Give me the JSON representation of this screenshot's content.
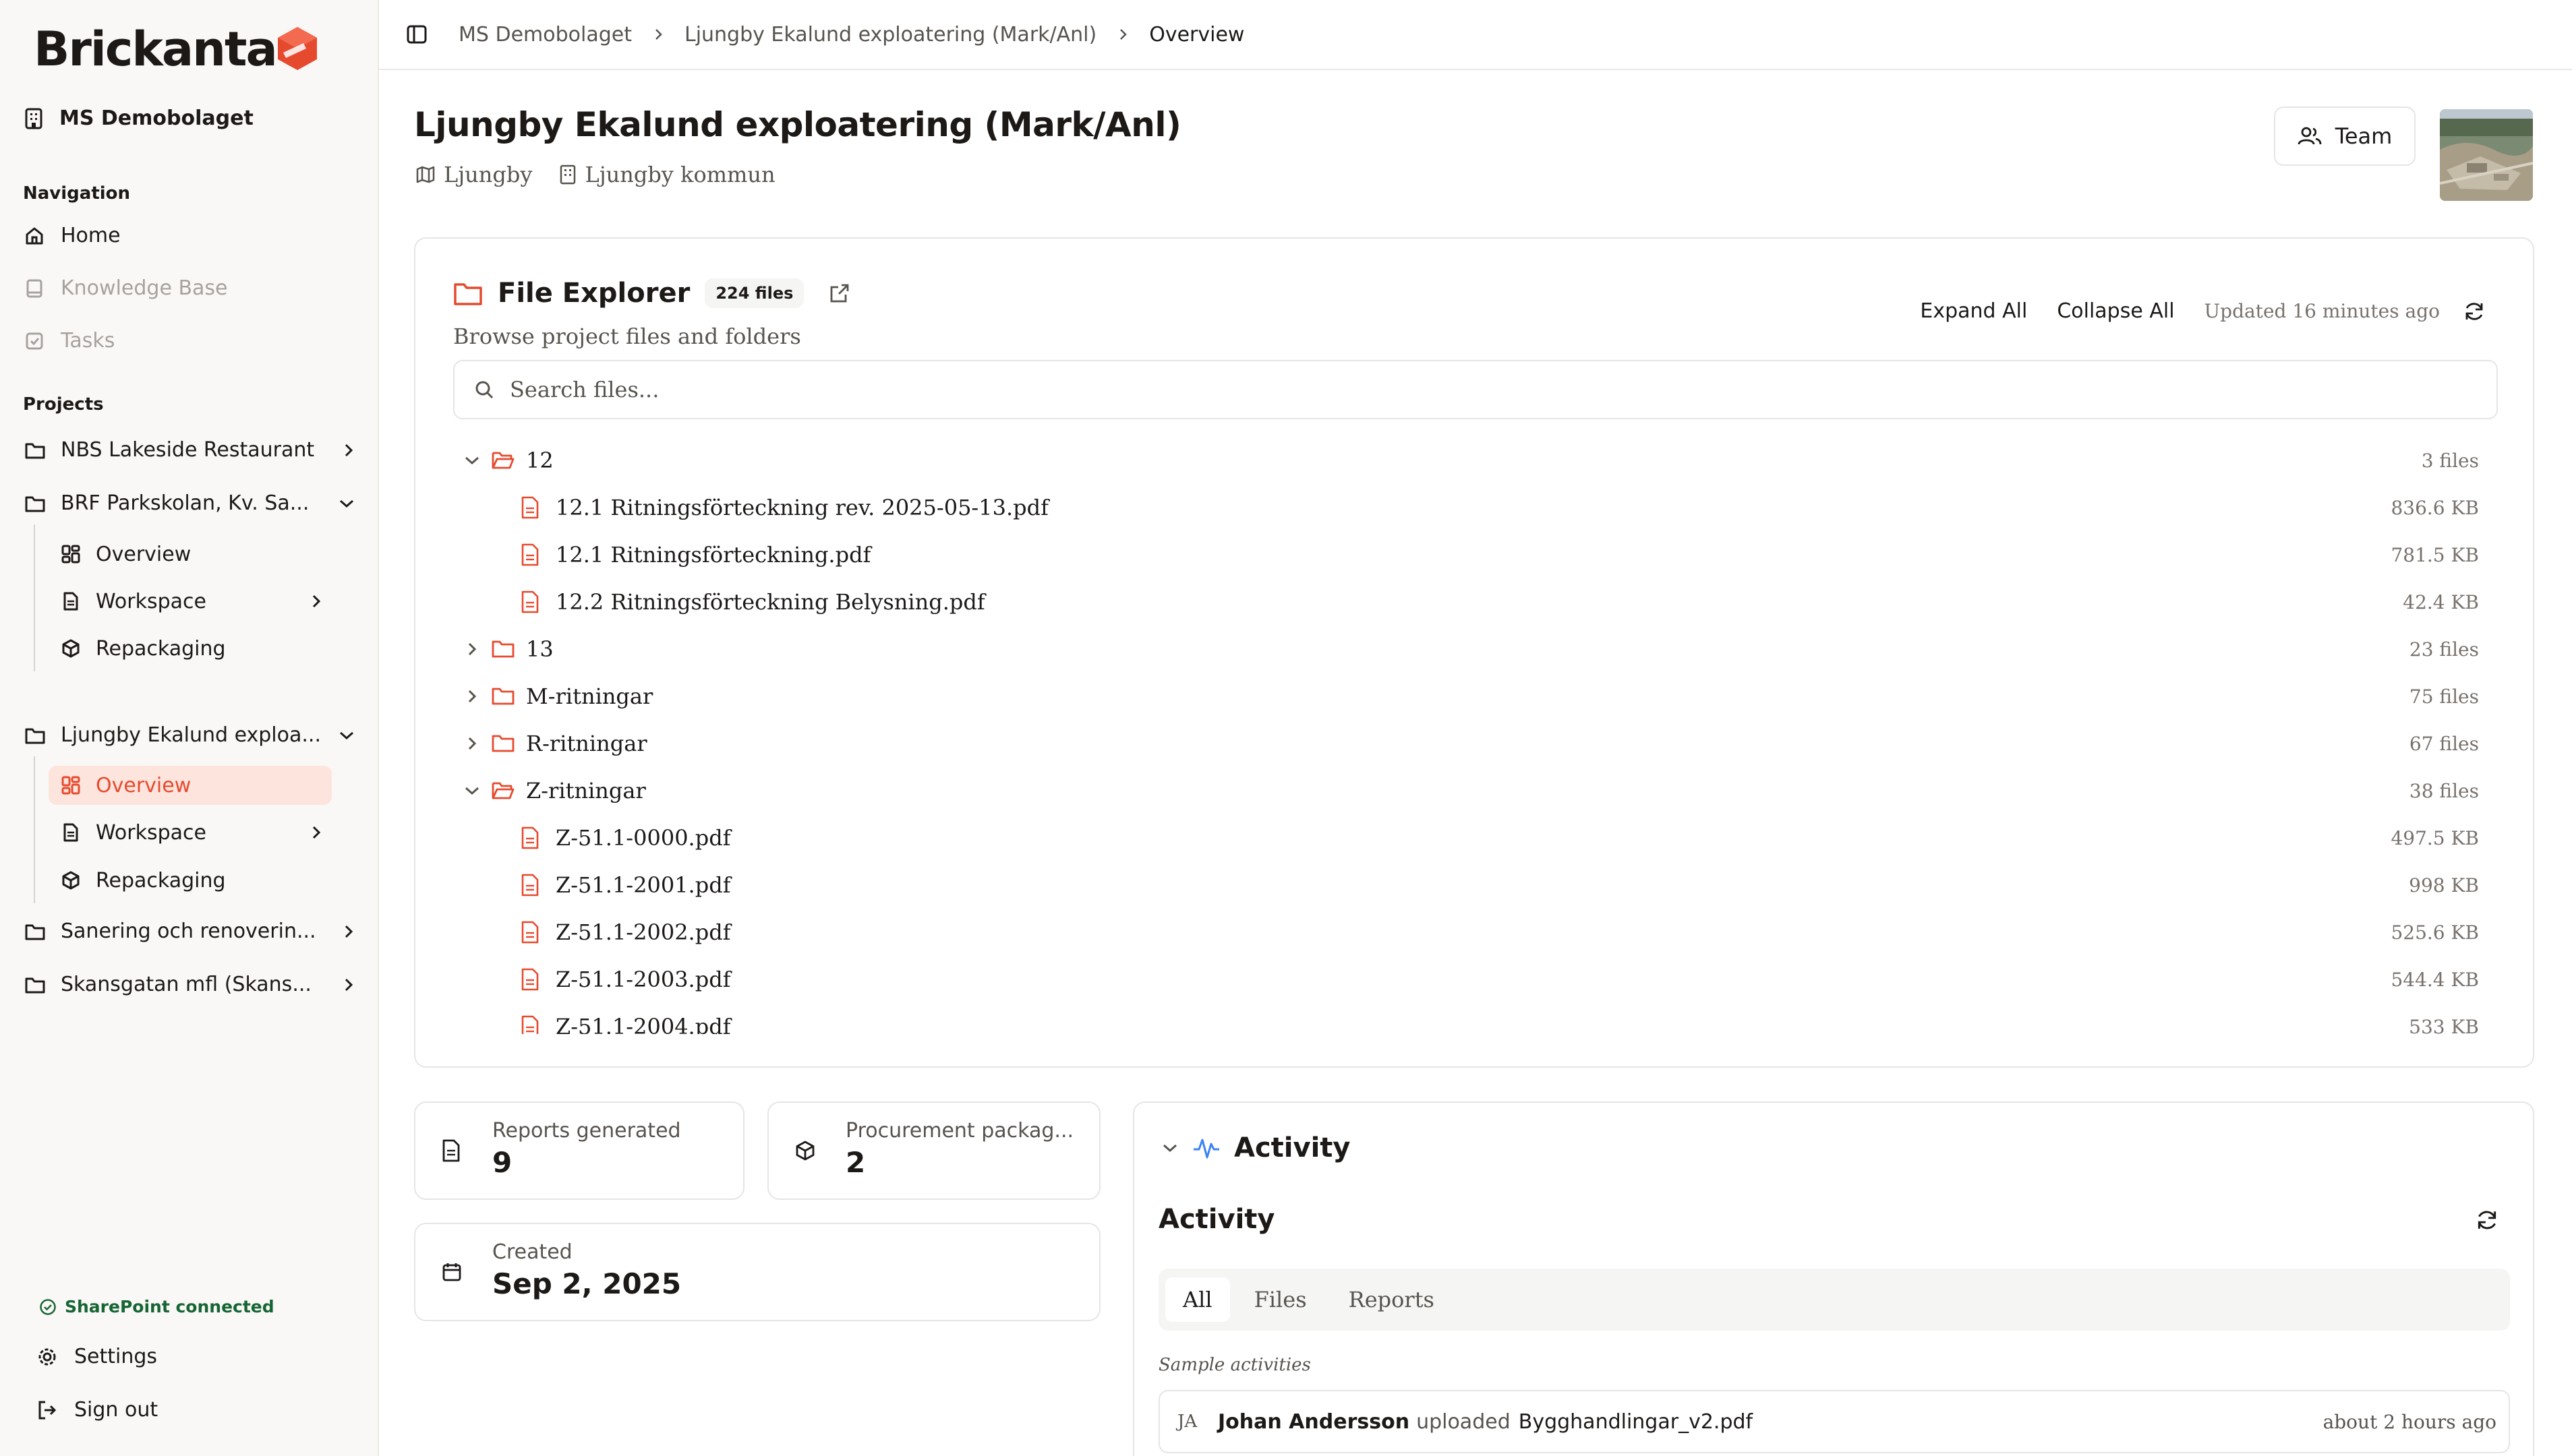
{
  "brand": {
    "name": "Brickanta",
    "accent": "#e64a2e"
  },
  "sidebar": {
    "org": "MS Demobolaget",
    "nav_label": "Navigation",
    "nav": [
      "Home",
      "Knowledge Base",
      "Tasks"
    ],
    "projects_label": "Projects",
    "projects": [
      {
        "name": "NBS Lakeside Restaurant"
      },
      {
        "name": "BRF Parkskolan, Kv. Sa..."
      },
      {
        "name": "Ljungby Ekalund exploa..."
      },
      {
        "name": "Sanering och renoverin..."
      },
      {
        "name": "Skansgatan mfl (Skans..."
      }
    ],
    "sub_items": [
      "Overview",
      "Workspace",
      "Repackaging"
    ],
    "sharepoint": "SharePoint connected",
    "settings": "Settings",
    "signout": "Sign out"
  },
  "breadcrumb": [
    "MS Demobolaget",
    "Ljungby Ekalund exploatering (Mark/Anl)",
    "Overview"
  ],
  "page": {
    "title": "Ljungby Ekalund exploatering (Mark/Anl)",
    "location": "Ljungby",
    "municipality": "Ljungby kommun",
    "team_button": "Team"
  },
  "file_explorer": {
    "title": "File Explorer",
    "count_badge": "224 files",
    "subtitle": "Browse project files and folders",
    "expand_all": "Expand All",
    "collapse_all": "Collapse All",
    "updated": "Updated 16 minutes ago",
    "search_placeholder": "Search files...",
    "rows": [
      {
        "type": "folder",
        "open": true,
        "name": "12",
        "meta": "3 files"
      },
      {
        "type": "file",
        "name": "12.1 Ritningsförteckning rev. 2025-05-13.pdf",
        "meta": "836.6 KB"
      },
      {
        "type": "file",
        "name": "12.1 Ritningsförteckning.pdf",
        "meta": "781.5 KB"
      },
      {
        "type": "file",
        "name": "12.2 Ritningsförteckning Belysning.pdf",
        "meta": "42.4 KB"
      },
      {
        "type": "folder",
        "open": false,
        "name": "13",
        "meta": "23 files"
      },
      {
        "type": "folder",
        "open": false,
        "name": "M-ritningar",
        "meta": "75 files"
      },
      {
        "type": "folder",
        "open": false,
        "name": "R-ritningar",
        "meta": "67 files"
      },
      {
        "type": "folder",
        "open": true,
        "name": "Z-ritningar",
        "meta": "38 files"
      },
      {
        "type": "file",
        "name": "Z-51.1-0000.pdf",
        "meta": "497.5 KB"
      },
      {
        "type": "file",
        "name": "Z-51.1-2001.pdf",
        "meta": "998 KB"
      },
      {
        "type": "file",
        "name": "Z-51.1-2002.pdf",
        "meta": "525.6 KB"
      },
      {
        "type": "file",
        "name": "Z-51.1-2003.pdf",
        "meta": "544.4 KB"
      },
      {
        "type": "file",
        "name": "Z-51.1-2004.pdf",
        "meta": "533 KB"
      }
    ]
  },
  "stats": {
    "reports_label": "Reports generated",
    "reports_value": "9",
    "procurement_label": "Procurement packag...",
    "procurement_value": "2",
    "created_label": "Created",
    "created_value": "Sep 2, 2025"
  },
  "activity": {
    "section_title": "Activity",
    "title": "Activity",
    "tabs": [
      "All",
      "Files",
      "Reports"
    ],
    "sample_label": "Sample activities",
    "items": [
      {
        "initials": "JA",
        "user": "Johan Andersson",
        "action": "uploaded",
        "file": "Bygghandlingar_v2.pdf",
        "time": "about 2 hours ago"
      }
    ]
  }
}
